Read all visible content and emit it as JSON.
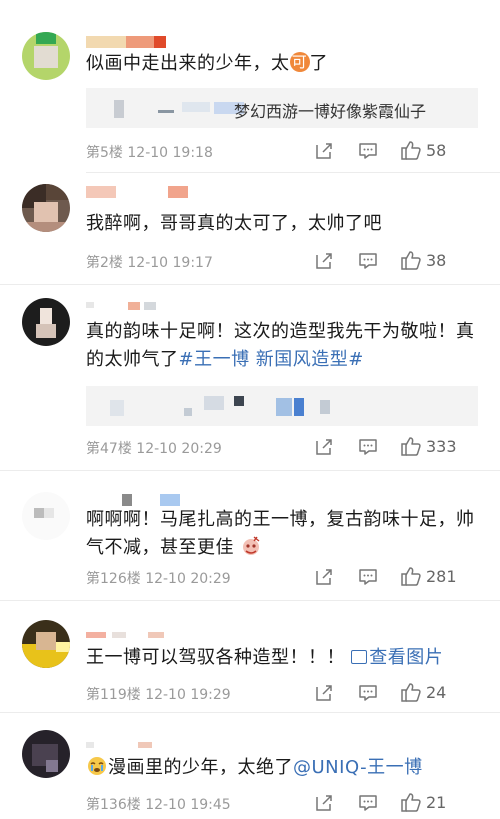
{
  "comments": [
    {
      "text": "似画中走出来的少年，太",
      "badge": "可",
      "text_after": "了",
      "quote": "梦幻西游一博好像紫霞仙子",
      "floor": "第5楼",
      "time": "12-10 19:18",
      "likes": "58"
    },
    {
      "text": "我醉啊，哥哥真的太可了，太帅了吧",
      "floor": "第2楼",
      "time": "12-10 19:17",
      "likes": "38"
    },
    {
      "line1": "真的韵味十足啊！这次的造型我先干为敬啦！真",
      "line2": "的太帅气了",
      "hashtag": "#王一博 新国风造型#",
      "floor": "第47楼",
      "time": "12-10 20:29",
      "likes": "333"
    },
    {
      "line1": "啊啊啊！马尾扎高的王一博，复古韵味十足，帅",
      "line2": "气不减，甚至更佳",
      "floor": "第126楼",
      "time": "12-10 20:29",
      "likes": "281"
    },
    {
      "text": "王一博可以驾驭各种造型！！！",
      "link": "查看图片",
      "floor": "第119楼",
      "time": "12-10 19:29",
      "likes": "24"
    },
    {
      "text": "漫画里的少年，太绝了",
      "mention": "@UNIQ-王一博",
      "floor": "第136楼",
      "time": "12-10 19:45",
      "likes": "21"
    }
  ],
  "icons": {
    "share": "share-icon",
    "comment": "comment-icon",
    "like": "thumbs-up-icon"
  },
  "colors": {
    "link": "#3a6fb5",
    "meta": "#9a9a9a"
  }
}
